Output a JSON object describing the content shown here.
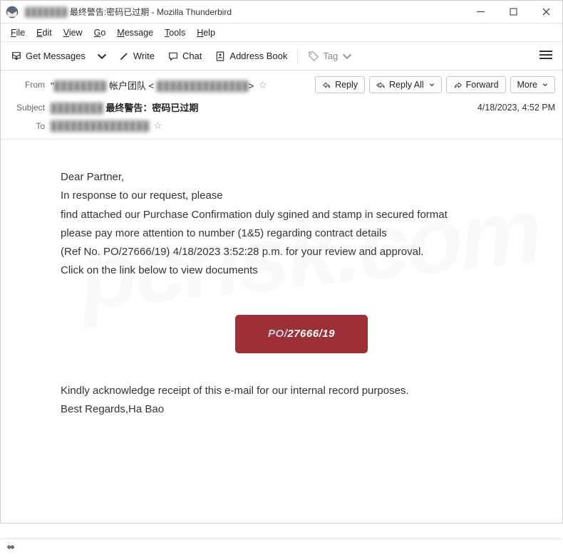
{
  "window": {
    "title_prefix_blurred": "███████",
    "title": "最终警告:密码已过期 - Mozilla Thunderbird"
  },
  "menu": {
    "file": "File",
    "edit": "Edit",
    "view": "View",
    "go": "Go",
    "message": "Message",
    "tools": "Tools",
    "help": "Help"
  },
  "toolbar": {
    "get_messages": "Get Messages",
    "write": "Write",
    "chat": "Chat",
    "address_book": "Address Book",
    "tag": "Tag"
  },
  "header": {
    "from_label": "From",
    "from_blurred_1": "████████",
    "from_team": "帐户团队 <",
    "from_blurred_2": "██████████████",
    "from_close": ">",
    "subject_label": "Subject",
    "subject_blurred": "████████",
    "subject_text": "最终警告：密码已过期",
    "to_label": "To",
    "to_blurred": "███████████████",
    "timestamp": "4/18/2023, 4:52 PM"
  },
  "actions": {
    "reply": "Reply",
    "reply_all": "Reply All",
    "forward": "Forward",
    "more": "More"
  },
  "body": {
    "greeting": "Dear Partner,",
    "l1": "In response to our request, please",
    "l2": "find attached our Purchase Confirmation duly sgined and stamp in secured format",
    "l3": "please pay more attention to number (1&5) regarding contract details",
    "l4": "(Ref No. PO/27666/19) 4/18/2023 3:52:28 p.m. for your review and approval.",
    "l5": "Click on the link below to view documents",
    "po_pre": "PO/",
    "po_num": "27666/19",
    "ack": "Kindly acknowledge  receipt of this e-mail for our internal record purposes.",
    "regards": "Best Regards,Ha Bao"
  },
  "watermark": "pcrisk.com"
}
